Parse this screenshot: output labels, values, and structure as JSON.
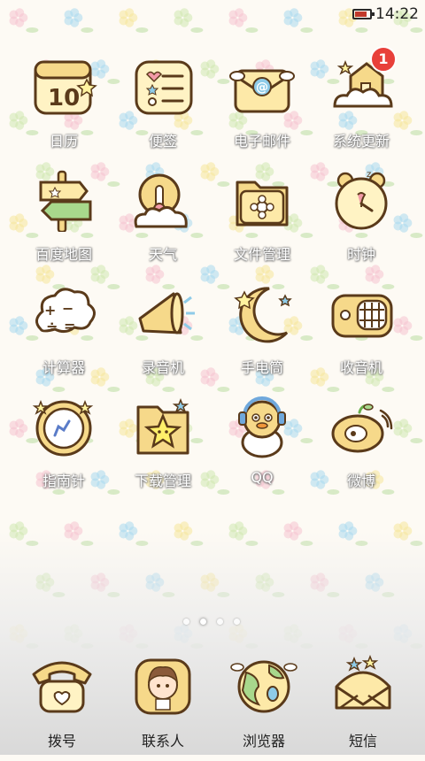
{
  "status_bar": {
    "time": "14:22",
    "battery_level": 0.8
  },
  "apps": [
    {
      "id": "calendar",
      "label": "日历",
      "icon": "calendar-icon"
    },
    {
      "id": "notes",
      "label": "便签",
      "icon": "notes-icon"
    },
    {
      "id": "email",
      "label": "电子邮件",
      "icon": "mail-icon"
    },
    {
      "id": "system-update",
      "label": "系统更新",
      "icon": "house-cloud-icon",
      "badge": "1"
    },
    {
      "id": "baidu-map",
      "label": "百度地图",
      "icon": "signpost-icon"
    },
    {
      "id": "weather",
      "label": "天气",
      "icon": "sun-cloud-icon"
    },
    {
      "id": "file-manager",
      "label": "文件管理",
      "icon": "folder-icon"
    },
    {
      "id": "clock",
      "label": "时钟",
      "icon": "alarm-clock-icon"
    },
    {
      "id": "calculator",
      "label": "计算器",
      "icon": "calculator-cloud-icon"
    },
    {
      "id": "recorder",
      "label": "录音机",
      "icon": "megaphone-icon"
    },
    {
      "id": "flashlight",
      "label": "手电筒",
      "icon": "moon-stars-icon"
    },
    {
      "id": "radio",
      "label": "收音机",
      "icon": "radio-icon"
    },
    {
      "id": "compass",
      "label": "指南针",
      "icon": "compass-icon"
    },
    {
      "id": "download-manager",
      "label": "下载管理",
      "icon": "star-folder-icon"
    },
    {
      "id": "qq",
      "label": "QQ",
      "icon": "penguin-icon"
    },
    {
      "id": "weibo",
      "label": "微博",
      "icon": "weibo-icon"
    }
  ],
  "page_indicator": {
    "count": 4,
    "active": 1
  },
  "dock": [
    {
      "id": "dialer",
      "label": "拨号",
      "icon": "telephone-icon"
    },
    {
      "id": "contacts",
      "label": "联系人",
      "icon": "contact-girl-icon"
    },
    {
      "id": "browser",
      "label": "浏览器",
      "icon": "globe-icon"
    },
    {
      "id": "messages",
      "label": "短信",
      "icon": "envelope-icon"
    }
  ]
}
